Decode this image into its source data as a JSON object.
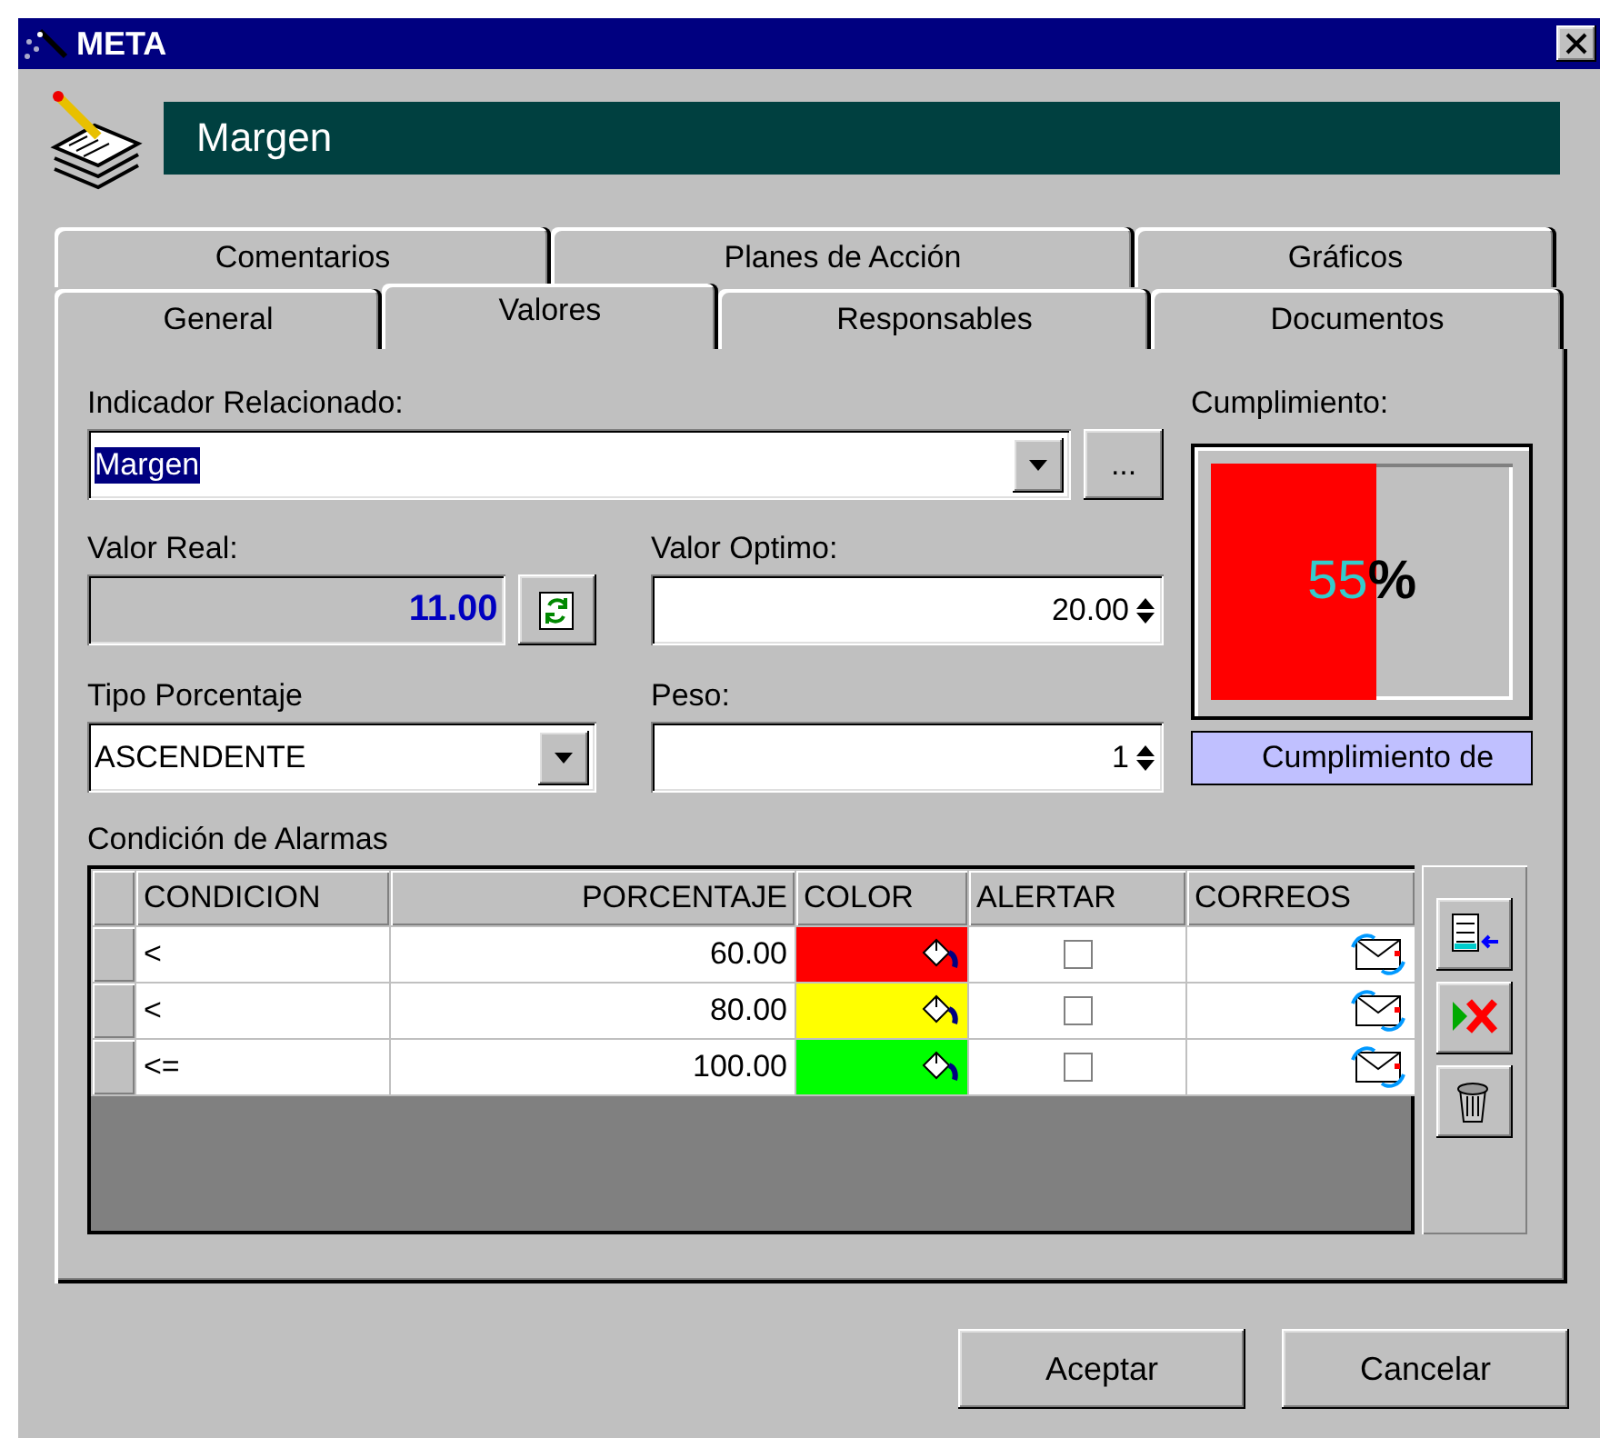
{
  "window": {
    "title": "META"
  },
  "header": {
    "title": "Margen"
  },
  "tab_rows": [
    {
      "tabs": [
        {
          "label": "Comentarios",
          "selected": false
        },
        {
          "label": "Planes de Acción",
          "selected": false
        },
        {
          "label": "Gráficos",
          "selected": false
        }
      ]
    },
    {
      "tabs": [
        {
          "label": "General",
          "selected": false
        },
        {
          "label": "Valores",
          "selected": true
        },
        {
          "label": "Responsables",
          "selected": false
        },
        {
          "label": "Documentos",
          "selected": false
        }
      ]
    }
  ],
  "indicador": {
    "label": "Indicador Relacionado:",
    "value": "Margen",
    "highlighted": true,
    "more_button": "..."
  },
  "valor_real": {
    "label": "Valor Real:",
    "value": "11.00"
  },
  "valor_optimo": {
    "label": "Valor Optimo:",
    "value": "20.00"
  },
  "tipo_porcentaje": {
    "label": "Tipo Porcentaje",
    "value": "ASCENDENTE"
  },
  "peso": {
    "label": "Peso:",
    "value": "1"
  },
  "cumplimiento": {
    "label": "Cumplimiento:",
    "level": 0.55,
    "value": "55",
    "unit": "%",
    "caption": "Cumplimiento de"
  },
  "alarmas": {
    "label": "Condición de Alarmas",
    "columns": [
      "CONDICION",
      "PORCENTAJE",
      "COLOR",
      "ALERTAR",
      "CORREOS"
    ],
    "rows": [
      {
        "condicion": "<",
        "porcentaje": "60.00",
        "color": "#ff0000",
        "alertar": false
      },
      {
        "condicion": "<",
        "porcentaje": "80.00",
        "color": "#ffff00",
        "alertar": false
      },
      {
        "condicion": "<=",
        "porcentaje": "100.00",
        "color": "#00ff00",
        "alertar": false
      }
    ]
  },
  "buttons": [
    {
      "label": "Aceptar"
    },
    {
      "label": "Cancelar"
    }
  ]
}
